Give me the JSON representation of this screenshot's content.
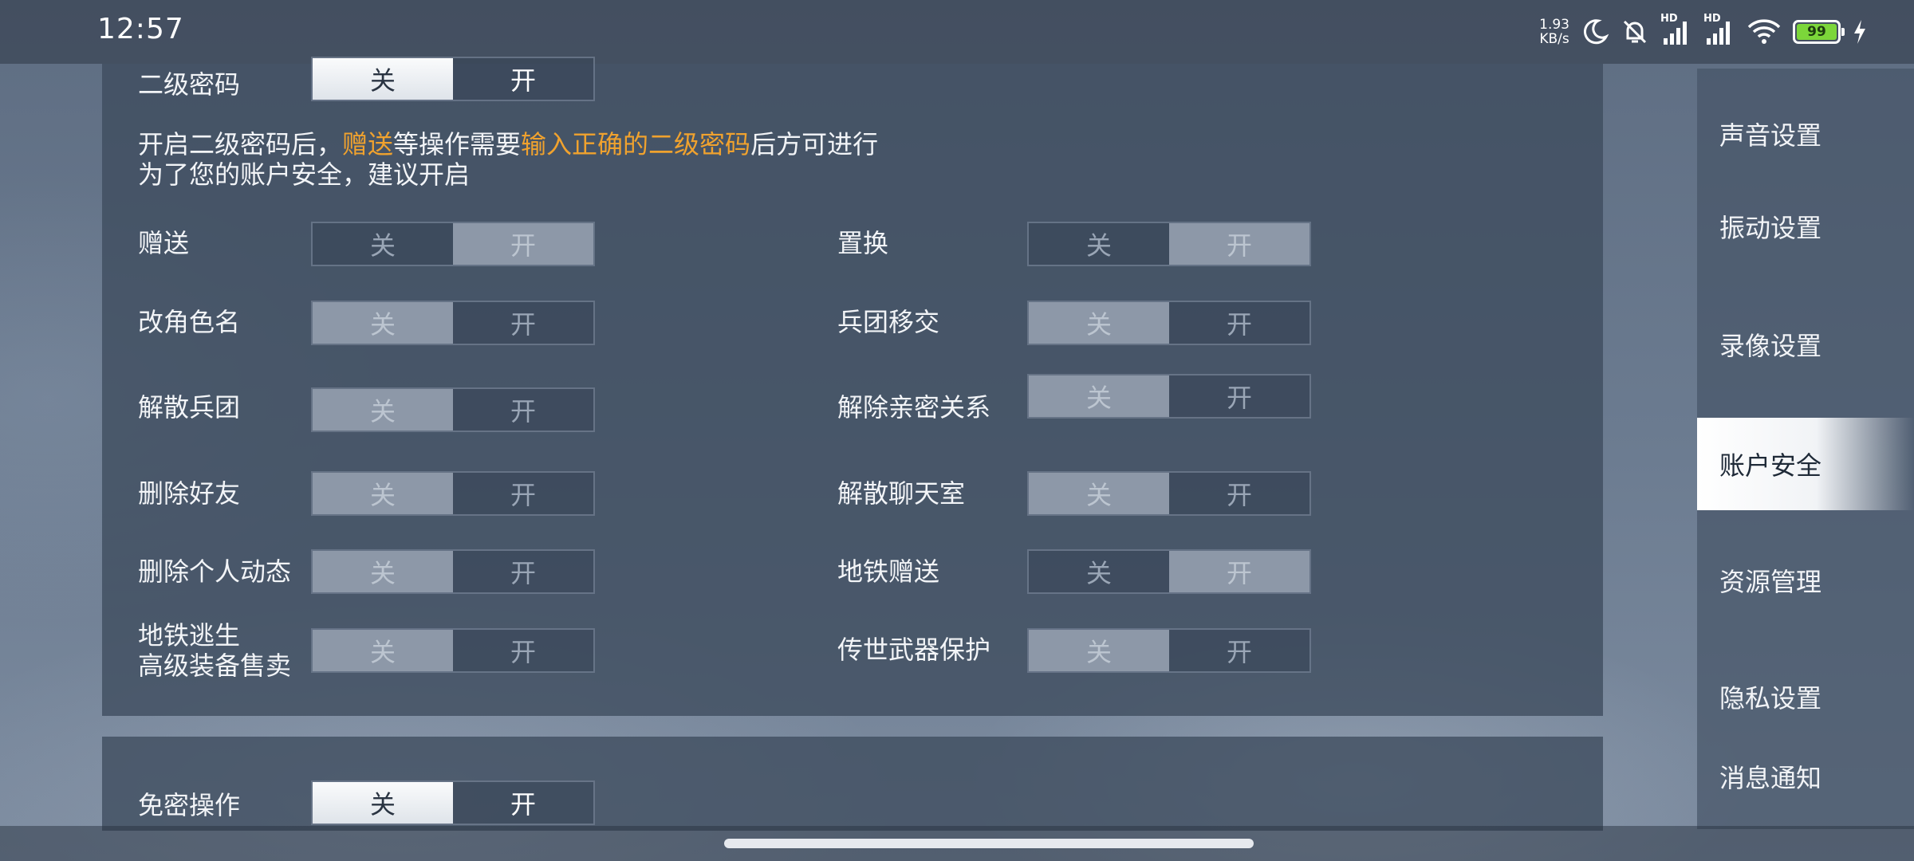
{
  "status_bar": {
    "time": "12:57",
    "net_speed_value": "1.93",
    "net_speed_unit": "KB/s",
    "signal_label_1": "HD",
    "signal_label_2": "HD",
    "battery": "99",
    "icons": [
      "moon-icon",
      "bell-off-icon",
      "signal-icon",
      "signal-icon",
      "wifi-icon",
      "battery-icon",
      "charging-icon"
    ]
  },
  "secondary_password": {
    "label": "二级密码",
    "off": "关",
    "on": "开",
    "selected": "off",
    "description": {
      "part1": "开启二级密码后，",
      "highlight1": "赠送",
      "part2": "等操作需要",
      "highlight2": "输入正确的二级密码",
      "part3": "后方可进行",
      "line2": "为了您的账户安全，建议开启"
    }
  },
  "settings": {
    "gift": {
      "label": "赠送",
      "off": "关",
      "on": "开",
      "selected": "on"
    },
    "replace": {
      "label": "置换",
      "off": "关",
      "on": "开",
      "selected": "on"
    },
    "rename": {
      "label": "改角色名",
      "off": "关",
      "on": "开",
      "selected": "off"
    },
    "legion_transfer": {
      "label": "兵团移交",
      "off": "关",
      "on": "开",
      "selected": "off"
    },
    "disband_legion": {
      "label": "解散兵团",
      "off": "关",
      "on": "开",
      "selected": "off"
    },
    "remove_intimacy": {
      "label": "解除亲密关系",
      "off": "关",
      "on": "开",
      "selected": "off"
    },
    "delete_friend": {
      "label": "删除好友",
      "off": "关",
      "on": "开",
      "selected": "off"
    },
    "disband_chatroom": {
      "label": "解散聊天室",
      "off": "关",
      "on": "开",
      "selected": "off"
    },
    "delete_moments": {
      "label": "删除个人动态",
      "off": "关",
      "on": "开",
      "selected": "off"
    },
    "metro_gift": {
      "label": "地铁赠送",
      "off": "关",
      "on": "开",
      "selected": "on"
    },
    "metro_sell": {
      "label_line1": "地铁逃生",
      "label_line2": "高级装备售卖",
      "off": "关",
      "on": "开",
      "selected": "off"
    },
    "legendary_weapon": {
      "label": "传世武器保护",
      "off": "关",
      "on": "开",
      "selected": "off"
    }
  },
  "password_free": {
    "label": "免密操作",
    "off": "关",
    "on": "开",
    "selected": "off"
  },
  "sidebar": {
    "items": [
      {
        "label": "声音设置"
      },
      {
        "label": "振动设置"
      },
      {
        "label": "录像设置"
      },
      {
        "label": "账户安全",
        "active": true
      },
      {
        "label": "资源管理"
      },
      {
        "label": "隐私设置"
      },
      {
        "label": "消息通知"
      }
    ]
  }
}
